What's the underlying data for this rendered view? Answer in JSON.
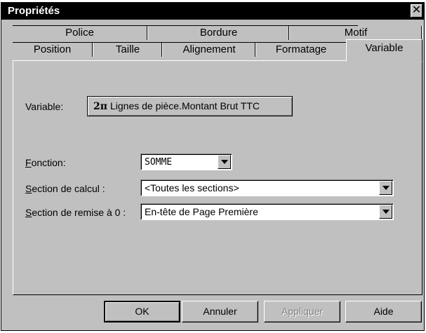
{
  "dialog": {
    "title": "Propriétés",
    "close_symbol": "✕"
  },
  "tabs": {
    "row1": [
      {
        "label": "Police"
      },
      {
        "label": "Bordure"
      },
      {
        "label": "Motif"
      }
    ],
    "row2": [
      {
        "label": "Position"
      },
      {
        "label": "Taille"
      },
      {
        "label": "Alignement"
      },
      {
        "label": "Formatage"
      },
      {
        "label": "Variable"
      }
    ],
    "active": "Variable"
  },
  "variable": {
    "label": "Variable:",
    "button_symbol": "2π",
    "button_text": "Lignes de pièce.Montant Brut TTC"
  },
  "fonction": {
    "label_accel": "F",
    "label_rest": "onction:",
    "value": "SOMME"
  },
  "section_calcul": {
    "label_accel": "S",
    "label_rest": "ection de calcul :",
    "value": "<Toutes les sections>"
  },
  "section_remise": {
    "label_accel": "S",
    "label_rest": "ection de remise à 0 :",
    "value": "En-tête de Page Première"
  },
  "buttons": {
    "ok": "OK",
    "cancel": "Annuler",
    "apply": "Appliquer",
    "help": "Aide"
  }
}
